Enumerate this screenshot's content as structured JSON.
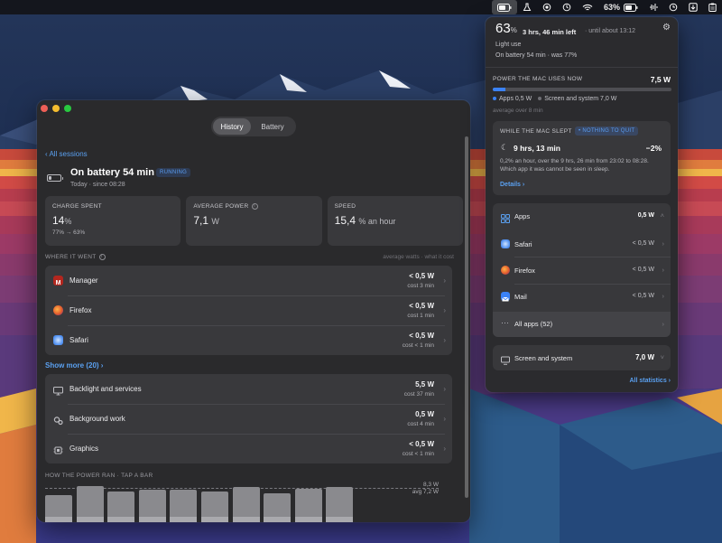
{
  "menubar": {
    "battery_percent": "63%"
  },
  "window": {
    "tabs": [
      {
        "label": "History"
      },
      {
        "label": "Battery"
      }
    ],
    "back_link": "‹ All sessions",
    "session": {
      "title": "On battery 54 min",
      "badge": "RUNNING",
      "subtitle": "Today · since 08:28"
    },
    "stats": [
      {
        "label": "CHARGE SPENT",
        "value": "14",
        "unit": "%",
        "foot": "77% → 63%"
      },
      {
        "label": "AVERAGE POWER",
        "value": "7,1",
        "unit": "W",
        "foot": ""
      },
      {
        "label": "SPEED",
        "value": "15,4",
        "unit": "% an hour",
        "foot": ""
      }
    ],
    "where_heading": "WHERE IT WENT",
    "where_right": "average watts · what it cost",
    "apps": [
      {
        "label": "Manager",
        "value": "< 0,5 W",
        "cost": "cost 3 min",
        "icon": "manager-icon",
        "color": "#b3261e"
      },
      {
        "label": "Firefox",
        "value": "< 0,5 W",
        "cost": "cost 1 min",
        "icon": "firefox-icon",
        "color": "#e25c2e"
      },
      {
        "label": "Safari",
        "value": "< 0,5 W",
        "cost": "cost < 1 min",
        "icon": "safari-icon",
        "color": "#4d8ef0"
      }
    ],
    "show_more": "Show more (20) ›",
    "system": [
      {
        "label": "Backlight and services",
        "value": "5,5 W",
        "cost": "cost 37 min",
        "icon": "display-icon"
      },
      {
        "label": "Background work",
        "value": "0,5 W",
        "cost": "cost 4 min",
        "icon": "gears-icon"
      },
      {
        "label": "Graphics",
        "value": "< 0,5 W",
        "cost": "cost < 1 min",
        "icon": "chip-icon"
      }
    ],
    "power_heading": "HOW THE POWER RAN · TAP A BAR",
    "power_max_label": "8,3 W",
    "power_avg_label": "avg 7,2 W",
    "chart_data": {
      "type": "bar",
      "values": [
        6.2,
        8.3,
        7.0,
        7.4,
        7.4,
        7.0,
        8.0,
        6.6,
        7.7,
        8.1
      ],
      "ylim": [
        0,
        8.3
      ],
      "avg": 7.2
    }
  },
  "panel": {
    "percent": "63",
    "percent_unit": "%",
    "time_left": "3 hrs, 46 min left",
    "until": "· until about 13:12",
    "use_label": "Light use",
    "on_battery": "On battery 54 min · was 77%",
    "power_label": "POWER THE MAC USES NOW",
    "power_value": "7,5 W",
    "apps_share": 0.07,
    "legend_apps": "Apps 0,5 W",
    "legend_screen": "Screen and system 7,0 W",
    "avg_line": "average over 8 min",
    "sleep": {
      "title": "WHILE THE MAC SLEPT",
      "badge": "• NOTHING TO QUIT",
      "duration": "9 hrs, 13 min",
      "pct": "−2%",
      "desc": "0,2% an hour, over the 9 hrs, 26 min from 23:02 to 08:28. Which app it was cannot be seen in sleep.",
      "details": "Details ›"
    },
    "apps_section": {
      "label": "Apps",
      "value": "0,5 W"
    },
    "apps": [
      {
        "label": "Safari",
        "value": "< 0,5 W",
        "icon": "safari-icon",
        "color": "#4d8ef0"
      },
      {
        "label": "Firefox",
        "value": "< 0,5 W",
        "icon": "firefox-icon",
        "color": "#e25c2e"
      },
      {
        "label": "Mail",
        "value": "< 0,5 W",
        "icon": "mail-icon",
        "color": "#3a82f7"
      }
    ],
    "all_apps": "All apps (52)",
    "screen_system": {
      "label": "Screen and system",
      "value": "7,0 W"
    },
    "all_statistics": "All statistics ›"
  },
  "colors": {
    "accent": "#3b82f6",
    "link": "#5aa0f0",
    "window_bg": "#2a2a2c",
    "card_bg": "#39393c"
  }
}
